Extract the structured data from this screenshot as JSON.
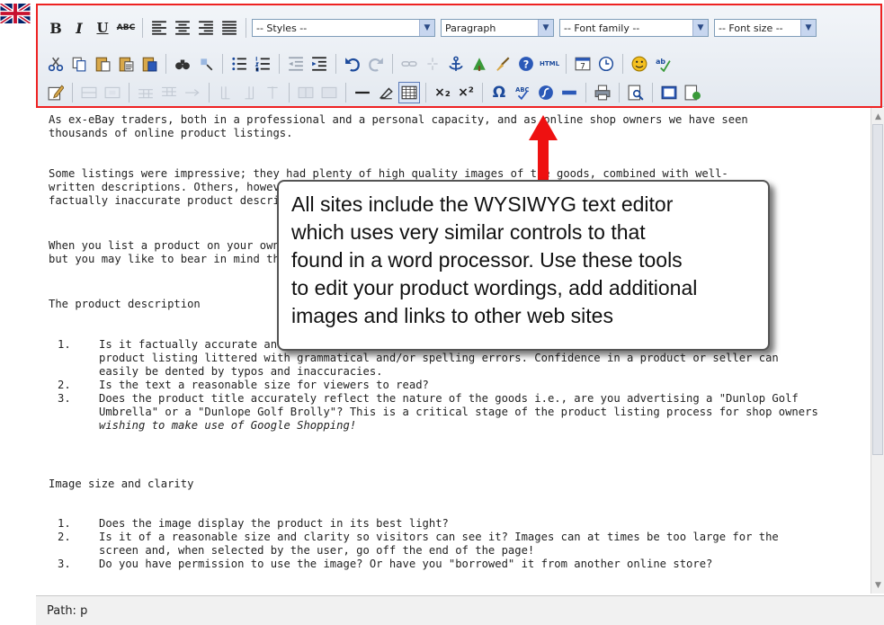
{
  "toolbar": {
    "row1": {
      "bold": "B",
      "italic": "I",
      "underline": "U",
      "strike": "ABC",
      "styles": "-- Styles --",
      "format": "Paragraph",
      "font_family": "-- Font family --",
      "font_size": "-- Font size --"
    },
    "row2": {
      "html": "HTML",
      "subscript": "x",
      "superscript": "x"
    },
    "row3": {
      "sub_label": "×₂",
      "sup_label": "×²",
      "omega": "Ω"
    }
  },
  "content": {
    "p1a": "As ex-eBay traders, both in a professional and a personal capacity, and as online shop owners we have seen",
    "p1b": "thousands of online product listings.",
    "p2a": "Some listings were impressive; they had plenty of high quality images of the goods, combined with well-",
    "p2b": "written descriptions. Others, however, were less impressive, with poor quality images and mis-spelt or",
    "p2c": "factually inaccurate product descriptions.",
    "p3a": "When you list a product on your own online shop, some of the following points may seem no-brainers",
    "p3b": "but you may like to bear in mind the following.",
    "h1": "The product description",
    "list1": [
      {
        "num": "1.",
        "lines": [
          "Is it factually accurate and free of spelling mistakes? Nothing is worse than trying to read a",
          "product listing littered with grammatical and/or spelling errors. Confidence in a product or seller can",
          "easily be dented by typos and inaccuracies."
        ]
      },
      {
        "num": "2.",
        "lines": [
          "Is the text a reasonable size for viewers to read?"
        ]
      },
      {
        "num": "3.",
        "lines": [
          "Does the product title accurately reflect the nature of the goods i.e., are you advertising a \"Dunlop Golf",
          "Umbrella\" or a \"Dunlope Golf Brolly\"? This is a critical stage of the product listing process for shop owners",
          "wishing to make use of Google Shopping!"
        ]
      }
    ],
    "h2": "Image size and clarity",
    "list2": [
      {
        "num": "1.",
        "lines": [
          "Does the image display the product in its best light?"
        ]
      },
      {
        "num": "2.",
        "lines": [
          "Is it of a reasonable size and clarity so visitors can see it? Images can at times be too large for the",
          "screen and, when selected by the user, go off the end of the page!"
        ]
      },
      {
        "num": "3.",
        "lines": [
          "Do you have permission to use the image? Or have you \"borrowed\" it from another online store?"
        ]
      }
    ]
  },
  "status": {
    "path": "Path: p"
  },
  "callout": {
    "line1": "All sites include the WYSIWYG text editor",
    "line2": "which uses very similar controls to that",
    "line3": "found in a word processor. Use these tools",
    "line4": "to edit your product wordings, add additional",
    "line5": "images and links to other web sites"
  },
  "colors": {
    "highlight": "#ee2222",
    "arrow": "#ee1111"
  }
}
